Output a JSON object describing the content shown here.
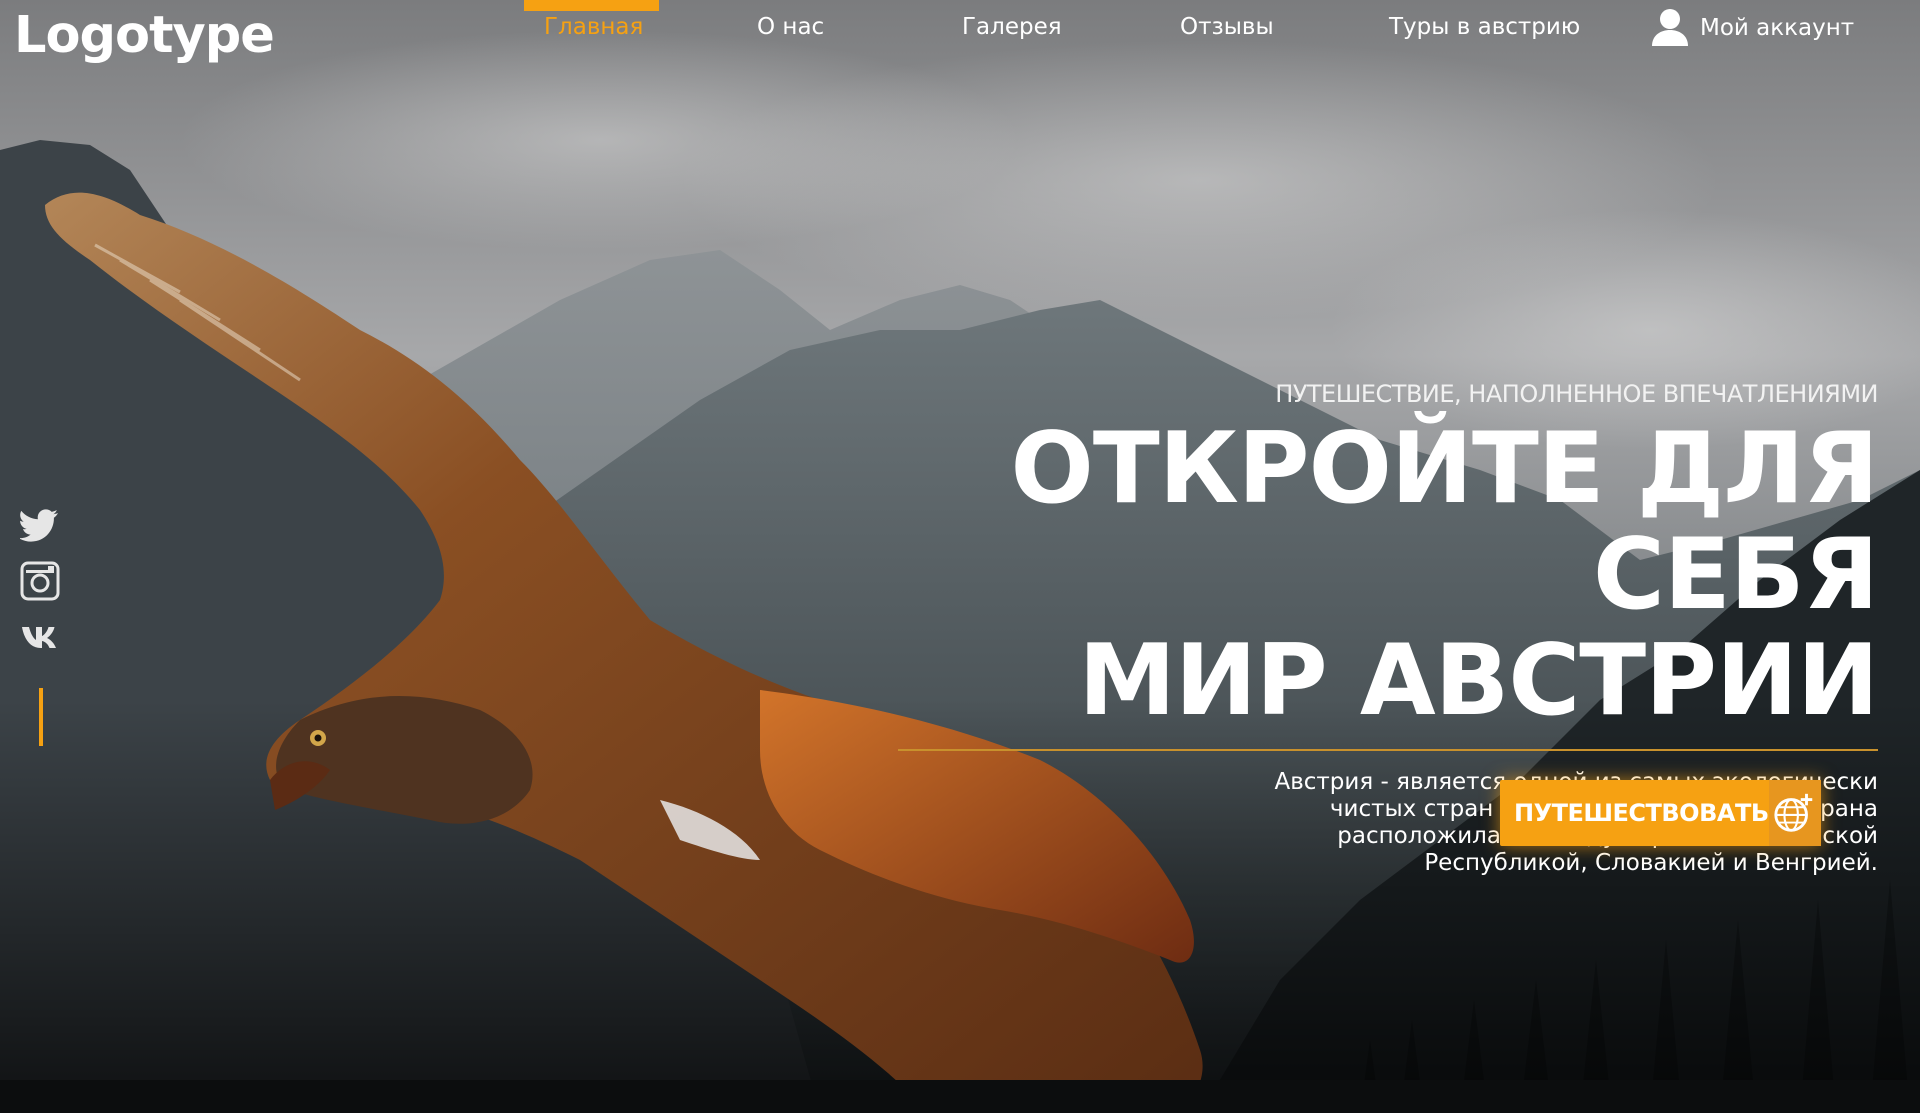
{
  "brand": {
    "logo_text": "Logotype"
  },
  "nav": {
    "items": [
      {
        "label": "Главная",
        "active": true
      },
      {
        "label": "О нас",
        "active": false
      },
      {
        "label": "Галерея",
        "active": false
      },
      {
        "label": "Отзывы",
        "active": false
      },
      {
        "label": "Туры в австрию",
        "active": false
      }
    ],
    "account": {
      "label": "Мой аккаунт",
      "icon": "user-icon"
    }
  },
  "social": [
    {
      "name": "twitter",
      "icon": "twitter-icon"
    },
    {
      "name": "instagram",
      "icon": "instagram-icon"
    },
    {
      "name": "vk",
      "icon": "vk-icon"
    }
  ],
  "hero": {
    "subtitle": "ПУТЕШЕСТВИЕ, НАПОЛНЕННОЕ ВПЕЧАТЛЕНИЯМИ",
    "headline_line1": "ОТКРОЙТЕ ДЛЯ СЕБЯ",
    "headline_line2": "МИР АВСТРИИ",
    "description": "Австрия - является одной из самых экологически чистых стран Европы. Эта маленькая страна расположилась между Германией, Чешской Республикой, Словакией и Венгрией.",
    "cta_label": "ПУТЕШЕСТВОВАТЬ",
    "cta_icon": "globe-plus-icon"
  },
  "colors": {
    "accent": "#f6a112",
    "text": "#ffffff",
    "sky": "#8c8d8f",
    "mountain": "#4a545a",
    "forest": "#1a2023",
    "bird_main": "#7a3b14",
    "bird_light": "#c57a39"
  }
}
